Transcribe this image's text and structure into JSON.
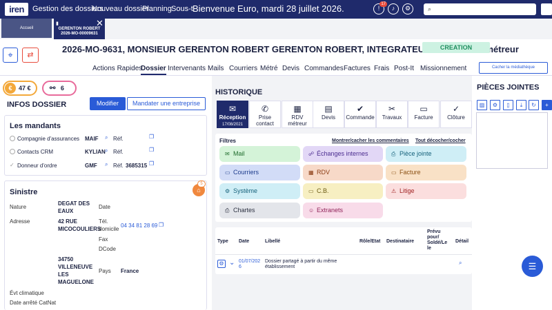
{
  "topbar": {
    "logo": "iren",
    "nav": [
      "Gestion des dossiers",
      "Nouveau dossier",
      "Planning",
      "Sous-traitance"
    ],
    "welcome": "Bienvenue Euro, mardi 28 juillet 2026.",
    "notif_count": "17",
    "search_placeholder": "Rechercher"
  },
  "tabs": {
    "home": "Accueil",
    "active_line1": "GERENTON ROBERT",
    "active_line2": "2026-MO-00009631"
  },
  "header": {
    "title": "2026-MO-9631, MONSIEUR GERENTON ROBERT GERENTON ROBERT, INTEGRATEUR OM / Aucun métreur",
    "status": "CREATION",
    "hide_button": "Cacher la médiathèque"
  },
  "menu": [
    "Actions Rapides",
    "Dossier",
    "Intervenants",
    "Mails",
    "Courriers",
    "Métré",
    "Devis",
    "Commandes",
    "Factures",
    "Frais",
    "Post-It",
    "Missionnement"
  ],
  "summary": {
    "amount": "47 €",
    "count": "6"
  },
  "infos": {
    "title": "INFOS DOSSIER",
    "modify": "Modifier",
    "mandate": "Mandater une entreprise"
  },
  "mandants": {
    "title": "Les mandants",
    "ref_label": "Réf.",
    "rows": [
      {
        "label": "Compagnie d'assurances",
        "code": "MAIF",
        "ref": ""
      },
      {
        "label": "Contacts CRM",
        "code": "KYLIAN",
        "ref": ""
      },
      {
        "label": "Donneur d'ordre",
        "code": "GMF",
        "ref": "3685315"
      }
    ]
  },
  "sinistre": {
    "title": "Sinistre",
    "home_badge": "5",
    "nature_label": "Nature",
    "nature_value_1": "DEGAT DES",
    "nature_value_2": "EAUX",
    "date_label": "Date",
    "address_label": "Adresse",
    "address_1": "42 RUE",
    "address_2": "MICOCOULIERS",
    "tel_label_1": "Tél.",
    "tel_label_2": "domicile",
    "tel_value": "04 34 81 28 69",
    "fax_label": "Fax",
    "dcode_label": "DCode",
    "city_1": "34750",
    "city_2": "VILLENEUVE",
    "city_3": "LES",
    "city_4": "MAGUELONE",
    "country_label": "Pays",
    "country_value": "France",
    "climat_label": "Évt climatique",
    "catnat_label": "Date arrêté CatNat"
  },
  "historique": {
    "title": "HISTORIQUE",
    "actions": [
      {
        "label": "Réception",
        "sub": "17/08/2021",
        "icon": "✉"
      },
      {
        "label": "Prise contact",
        "sub": "",
        "icon": "✆"
      },
      {
        "label": "RDV métreur",
        "sub": "",
        "icon": "▦"
      },
      {
        "label": "Devis",
        "sub": "",
        "icon": "▤"
      },
      {
        "label": "Commande",
        "sub": "",
        "icon": "✔"
      },
      {
        "label": "Travaux",
        "sub": "",
        "icon": "✂"
      },
      {
        "label": "Facture",
        "sub": "",
        "icon": "▭"
      },
      {
        "label": "Clôture",
        "sub": "",
        "icon": "✓"
      }
    ],
    "filters_label": "Filtres",
    "filters_toggle": "Montrer/cacher les commentaires",
    "filters_reset": "Tout décocher/cocher",
    "chips": [
      {
        "label": "Mail",
        "icon": "✉",
        "bg": "#d4f3d8",
        "fg": "#1e6b2c"
      },
      {
        "label": "Échanges internes",
        "icon": "☍",
        "bg": "#e2d7f6",
        "fg": "#4a2b8f"
      },
      {
        "label": "Pièce jointe",
        "icon": "⎙",
        "bg": "#cfeef6",
        "fg": "#15617a"
      },
      {
        "label": "Courriers",
        "icon": "▭",
        "bg": "#d2dcf7",
        "fg": "#1d3b8c"
      },
      {
        "label": "RDV",
        "icon": "▦",
        "bg": "#f7d9c8",
        "fg": "#8a3b12"
      },
      {
        "label": "Facture",
        "icon": "▭",
        "bg": "#f9e1c6",
        "fg": "#8a4f12"
      },
      {
        "label": "Système",
        "icon": "⚙",
        "bg": "#cfeef6",
        "fg": "#15617a"
      },
      {
        "label": "C.B.",
        "icon": "▭",
        "bg": "#f7efc2",
        "fg": "#6b5a12"
      },
      {
        "label": "Litige",
        "icon": "⚠",
        "bg": "#fbdede",
        "fg": "#a12222"
      },
      {
        "label": "Chartes",
        "icon": "⎙",
        "bg": "#e3e5ea",
        "fg": "#2b3040"
      },
      {
        "label": "Extranets",
        "icon": "☺",
        "bg": "#f8dbe9",
        "fg": "#8f2258"
      }
    ],
    "table_headers": {
      "type": "Type",
      "date": "Date",
      "libelle": "Libellé",
      "role": "Rôle/Etat",
      "dest": "Destinataire",
      "prevu_1": "Prévu",
      "prevu_2": "pour/",
      "prevu_3": "Soldé/Le",
      "prevu_4": "le",
      "detail": "Détail"
    },
    "row": {
      "date_1": "01/07/202",
      "date_2": "6",
      "libelle_1": "Dossier partagé à partir du même",
      "libelle_2": "établissement"
    }
  },
  "pieces": {
    "title": "PIÈCES JOINTES"
  }
}
